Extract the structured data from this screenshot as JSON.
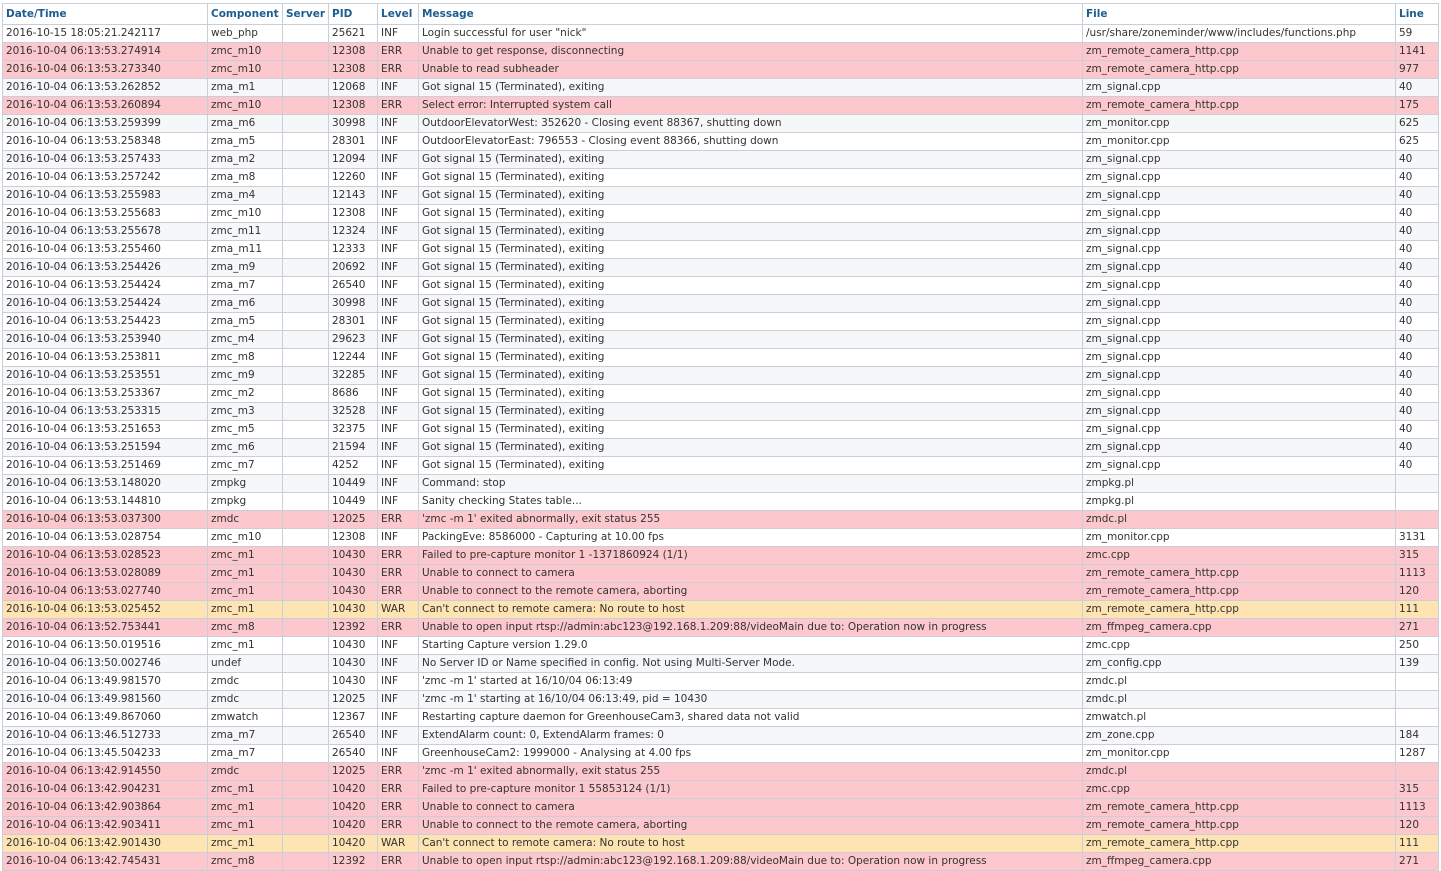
{
  "columns": [
    {
      "key": "datetime",
      "label": "Date/Time"
    },
    {
      "key": "component",
      "label": "Component"
    },
    {
      "key": "server",
      "label": "Server"
    },
    {
      "key": "pid",
      "label": "PID"
    },
    {
      "key": "level",
      "label": "Level"
    },
    {
      "key": "message",
      "label": "Message"
    },
    {
      "key": "file",
      "label": "File"
    },
    {
      "key": "line",
      "label": "Line"
    }
  ],
  "level_colors": {
    "INF": "#ffffff",
    "ERR": "#fcc8cd",
    "WAR": "#fee3b3"
  },
  "rows": [
    {
      "datetime": "2016-10-15 18:05:21.242117",
      "component": "web_php",
      "server": "",
      "pid": "25621",
      "level": "INF",
      "message": "Login successful for user \"nick\"",
      "file": "/usr/share/zoneminder/www/includes/functions.php",
      "line": "59"
    },
    {
      "datetime": "2016-10-04 06:13:53.274914",
      "component": "zmc_m10",
      "server": "",
      "pid": "12308",
      "level": "ERR",
      "message": "Unable to get response, disconnecting",
      "file": "zm_remote_camera_http.cpp",
      "line": "1141"
    },
    {
      "datetime": "2016-10-04 06:13:53.273340",
      "component": "zmc_m10",
      "server": "",
      "pid": "12308",
      "level": "ERR",
      "message": "Unable to read subheader",
      "file": "zm_remote_camera_http.cpp",
      "line": "977"
    },
    {
      "datetime": "2016-10-04 06:13:53.262852",
      "component": "zma_m1",
      "server": "",
      "pid": "12068",
      "level": "INF",
      "message": "Got signal 15 (Terminated), exiting",
      "file": "zm_signal.cpp",
      "line": "40"
    },
    {
      "datetime": "2016-10-04 06:13:53.260894",
      "component": "zmc_m10",
      "server": "",
      "pid": "12308",
      "level": "ERR",
      "message": "Select error: Interrupted system call",
      "file": "zm_remote_camera_http.cpp",
      "line": "175"
    },
    {
      "datetime": "2016-10-04 06:13:53.259399",
      "component": "zma_m6",
      "server": "",
      "pid": "30998",
      "level": "INF",
      "message": "OutdoorElevatorWest: 352620 - Closing event 88367, shutting down",
      "file": "zm_monitor.cpp",
      "line": "625"
    },
    {
      "datetime": "2016-10-04 06:13:53.258348",
      "component": "zma_m5",
      "server": "",
      "pid": "28301",
      "level": "INF",
      "message": "OutdoorElevatorEast: 796553 - Closing event 88366, shutting down",
      "file": "zm_monitor.cpp",
      "line": "625"
    },
    {
      "datetime": "2016-10-04 06:13:53.257433",
      "component": "zma_m2",
      "server": "",
      "pid": "12094",
      "level": "INF",
      "message": "Got signal 15 (Terminated), exiting",
      "file": "zm_signal.cpp",
      "line": "40"
    },
    {
      "datetime": "2016-10-04 06:13:53.257242",
      "component": "zma_m8",
      "server": "",
      "pid": "12260",
      "level": "INF",
      "message": "Got signal 15 (Terminated), exiting",
      "file": "zm_signal.cpp",
      "line": "40"
    },
    {
      "datetime": "2016-10-04 06:13:53.255983",
      "component": "zma_m4",
      "server": "",
      "pid": "12143",
      "level": "INF",
      "message": "Got signal 15 (Terminated), exiting",
      "file": "zm_signal.cpp",
      "line": "40"
    },
    {
      "datetime": "2016-10-04 06:13:53.255683",
      "component": "zmc_m10",
      "server": "",
      "pid": "12308",
      "level": "INF",
      "message": "Got signal 15 (Terminated), exiting",
      "file": "zm_signal.cpp",
      "line": "40"
    },
    {
      "datetime": "2016-10-04 06:13:53.255678",
      "component": "zmc_m11",
      "server": "",
      "pid": "12324",
      "level": "INF",
      "message": "Got signal 15 (Terminated), exiting",
      "file": "zm_signal.cpp",
      "line": "40"
    },
    {
      "datetime": "2016-10-04 06:13:53.255460",
      "component": "zma_m11",
      "server": "",
      "pid": "12333",
      "level": "INF",
      "message": "Got signal 15 (Terminated), exiting",
      "file": "zm_signal.cpp",
      "line": "40"
    },
    {
      "datetime": "2016-10-04 06:13:53.254426",
      "component": "zma_m9",
      "server": "",
      "pid": "20692",
      "level": "INF",
      "message": "Got signal 15 (Terminated), exiting",
      "file": "zm_signal.cpp",
      "line": "40"
    },
    {
      "datetime": "2016-10-04 06:13:53.254424",
      "component": "zma_m7",
      "server": "",
      "pid": "26540",
      "level": "INF",
      "message": "Got signal 15 (Terminated), exiting",
      "file": "zm_signal.cpp",
      "line": "40"
    },
    {
      "datetime": "2016-10-04 06:13:53.254424",
      "component": "zma_m6",
      "server": "",
      "pid": "30998",
      "level": "INF",
      "message": "Got signal 15 (Terminated), exiting",
      "file": "zm_signal.cpp",
      "line": "40"
    },
    {
      "datetime": "2016-10-04 06:13:53.254423",
      "component": "zma_m5",
      "server": "",
      "pid": "28301",
      "level": "INF",
      "message": "Got signal 15 (Terminated), exiting",
      "file": "zm_signal.cpp",
      "line": "40"
    },
    {
      "datetime": "2016-10-04 06:13:53.253940",
      "component": "zmc_m4",
      "server": "",
      "pid": "29623",
      "level": "INF",
      "message": "Got signal 15 (Terminated), exiting",
      "file": "zm_signal.cpp",
      "line": "40"
    },
    {
      "datetime": "2016-10-04 06:13:53.253811",
      "component": "zmc_m8",
      "server": "",
      "pid": "12244",
      "level": "INF",
      "message": "Got signal 15 (Terminated), exiting",
      "file": "zm_signal.cpp",
      "line": "40"
    },
    {
      "datetime": "2016-10-04 06:13:53.253551",
      "component": "zmc_m9",
      "server": "",
      "pid": "32285",
      "level": "INF",
      "message": "Got signal 15 (Terminated), exiting",
      "file": "zm_signal.cpp",
      "line": "40"
    },
    {
      "datetime": "2016-10-04 06:13:53.253367",
      "component": "zmc_m2",
      "server": "",
      "pid": "8686",
      "level": "INF",
      "message": "Got signal 15 (Terminated), exiting",
      "file": "zm_signal.cpp",
      "line": "40"
    },
    {
      "datetime": "2016-10-04 06:13:53.253315",
      "component": "zmc_m3",
      "server": "",
      "pid": "32528",
      "level": "INF",
      "message": "Got signal 15 (Terminated), exiting",
      "file": "zm_signal.cpp",
      "line": "40"
    },
    {
      "datetime": "2016-10-04 06:13:53.251653",
      "component": "zmc_m5",
      "server": "",
      "pid": "32375",
      "level": "INF",
      "message": "Got signal 15 (Terminated), exiting",
      "file": "zm_signal.cpp",
      "line": "40"
    },
    {
      "datetime": "2016-10-04 06:13:53.251594",
      "component": "zmc_m6",
      "server": "",
      "pid": "21594",
      "level": "INF",
      "message": "Got signal 15 (Terminated), exiting",
      "file": "zm_signal.cpp",
      "line": "40"
    },
    {
      "datetime": "2016-10-04 06:13:53.251469",
      "component": "zmc_m7",
      "server": "",
      "pid": "4252",
      "level": "INF",
      "message": "Got signal 15 (Terminated), exiting",
      "file": "zm_signal.cpp",
      "line": "40"
    },
    {
      "datetime": "2016-10-04 06:13:53.148020",
      "component": "zmpkg",
      "server": "",
      "pid": "10449",
      "level": "INF",
      "message": "Command: stop",
      "file": "zmpkg.pl",
      "line": ""
    },
    {
      "datetime": "2016-10-04 06:13:53.144810",
      "component": "zmpkg",
      "server": "",
      "pid": "10449",
      "level": "INF",
      "message": "Sanity checking States table...",
      "file": "zmpkg.pl",
      "line": ""
    },
    {
      "datetime": "2016-10-04 06:13:53.037300",
      "component": "zmdc",
      "server": "",
      "pid": "12025",
      "level": "ERR",
      "message": "'zmc -m 1' exited abnormally, exit status 255",
      "file": "zmdc.pl",
      "line": ""
    },
    {
      "datetime": "2016-10-04 06:13:53.028754",
      "component": "zmc_m10",
      "server": "",
      "pid": "12308",
      "level": "INF",
      "message": "PackingEve: 8586000 - Capturing at 10.00 fps",
      "file": "zm_monitor.cpp",
      "line": "3131"
    },
    {
      "datetime": "2016-10-04 06:13:53.028523",
      "component": "zmc_m1",
      "server": "",
      "pid": "10430",
      "level": "ERR",
      "message": "Failed to pre-capture monitor 1 -1371860924 (1/1)",
      "file": "zmc.cpp",
      "line": "315"
    },
    {
      "datetime": "2016-10-04 06:13:53.028089",
      "component": "zmc_m1",
      "server": "",
      "pid": "10430",
      "level": "ERR",
      "message": "Unable to connect to camera",
      "file": "zm_remote_camera_http.cpp",
      "line": "1113"
    },
    {
      "datetime": "2016-10-04 06:13:53.027740",
      "component": "zmc_m1",
      "server": "",
      "pid": "10430",
      "level": "ERR",
      "message": "Unable to connect to the remote camera, aborting",
      "file": "zm_remote_camera_http.cpp",
      "line": "120"
    },
    {
      "datetime": "2016-10-04 06:13:53.025452",
      "component": "zmc_m1",
      "server": "",
      "pid": "10430",
      "level": "WAR",
      "message": "Can't connect to remote camera: No route to host",
      "file": "zm_remote_camera_http.cpp",
      "line": "111"
    },
    {
      "datetime": "2016-10-04 06:13:52.753441",
      "component": "zmc_m8",
      "server": "",
      "pid": "12392",
      "level": "ERR",
      "message": "Unable to open input rtsp://admin:abc123@192.168.1.209:88/videoMain due to: Operation now in progress",
      "file": "zm_ffmpeg_camera.cpp",
      "line": "271"
    },
    {
      "datetime": "2016-10-04 06:13:50.019516",
      "component": "zmc_m1",
      "server": "",
      "pid": "10430",
      "level": "INF",
      "message": "Starting Capture version 1.29.0",
      "file": "zmc.cpp",
      "line": "250"
    },
    {
      "datetime": "2016-10-04 06:13:50.002746",
      "component": "undef",
      "server": "",
      "pid": "10430",
      "level": "INF",
      "message": "No Server ID or Name specified in config. Not using Multi-Server Mode.",
      "file": "zm_config.cpp",
      "line": "139"
    },
    {
      "datetime": "2016-10-04 06:13:49.981570",
      "component": "zmdc",
      "server": "",
      "pid": "10430",
      "level": "INF",
      "message": "'zmc -m 1' started at 16/10/04 06:13:49",
      "file": "zmdc.pl",
      "line": ""
    },
    {
      "datetime": "2016-10-04 06:13:49.981560",
      "component": "zmdc",
      "server": "",
      "pid": "12025",
      "level": "INF",
      "message": "'zmc -m 1' starting at 16/10/04 06:13:49, pid = 10430",
      "file": "zmdc.pl",
      "line": ""
    },
    {
      "datetime": "2016-10-04 06:13:49.867060",
      "component": "zmwatch",
      "server": "",
      "pid": "12367",
      "level": "INF",
      "message": "Restarting capture daemon for GreenhouseCam3, shared data not valid",
      "file": "zmwatch.pl",
      "line": ""
    },
    {
      "datetime": "2016-10-04 06:13:46.512733",
      "component": "zma_m7",
      "server": "",
      "pid": "26540",
      "level": "INF",
      "message": "ExtendAlarm count: 0, ExtendAlarm frames: 0",
      "file": "zm_zone.cpp",
      "line": "184"
    },
    {
      "datetime": "2016-10-04 06:13:45.504233",
      "component": "zma_m7",
      "server": "",
      "pid": "26540",
      "level": "INF",
      "message": "GreenhouseCam2: 1999000 - Analysing at 4.00 fps",
      "file": "zm_monitor.cpp",
      "line": "1287"
    },
    {
      "datetime": "2016-10-04 06:13:42.914550",
      "component": "zmdc",
      "server": "",
      "pid": "12025",
      "level": "ERR",
      "message": "'zmc -m 1' exited abnormally, exit status 255",
      "file": "zmdc.pl",
      "line": ""
    },
    {
      "datetime": "2016-10-04 06:13:42.904231",
      "component": "zmc_m1",
      "server": "",
      "pid": "10420",
      "level": "ERR",
      "message": "Failed to pre-capture monitor 1 55853124 (1/1)",
      "file": "zmc.cpp",
      "line": "315"
    },
    {
      "datetime": "2016-10-04 06:13:42.903864",
      "component": "zmc_m1",
      "server": "",
      "pid": "10420",
      "level": "ERR",
      "message": "Unable to connect to camera",
      "file": "zm_remote_camera_http.cpp",
      "line": "1113"
    },
    {
      "datetime": "2016-10-04 06:13:42.903411",
      "component": "zmc_m1",
      "server": "",
      "pid": "10420",
      "level": "ERR",
      "message": "Unable to connect to the remote camera, aborting",
      "file": "zm_remote_camera_http.cpp",
      "line": "120"
    },
    {
      "datetime": "2016-10-04 06:13:42.901430",
      "component": "zmc_m1",
      "server": "",
      "pid": "10420",
      "level": "WAR",
      "message": "Can't connect to remote camera: No route to host",
      "file": "zm_remote_camera_http.cpp",
      "line": "111"
    },
    {
      "datetime": "2016-10-04 06:13:42.745431",
      "component": "zmc_m8",
      "server": "",
      "pid": "12392",
      "level": "ERR",
      "message": "Unable to open input rtsp://admin:abc123@192.168.1.209:88/videoMain due to: Operation now in progress",
      "file": "zm_ffmpeg_camera.cpp",
      "line": "271"
    }
  ]
}
